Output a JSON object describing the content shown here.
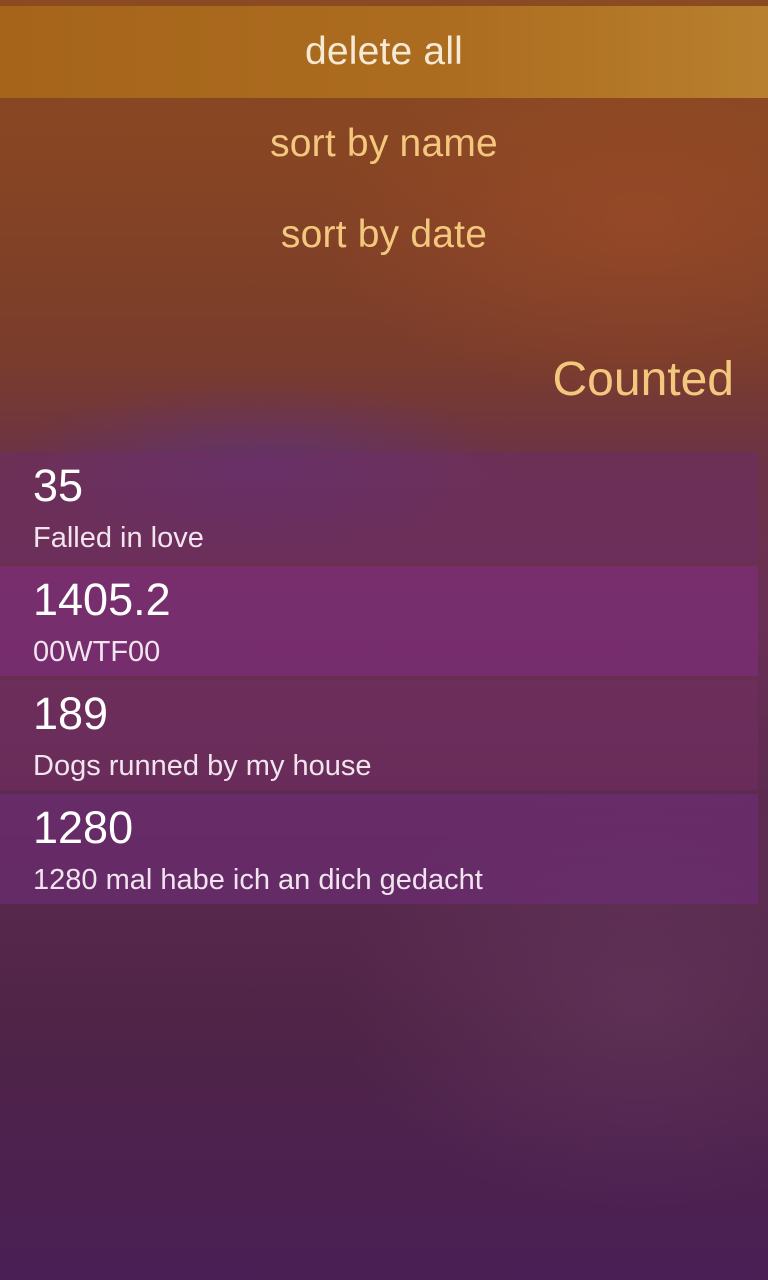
{
  "menu": {
    "items": [
      {
        "label": "delete all",
        "highlighted": true
      },
      {
        "label": "sort by name",
        "highlighted": false
      },
      {
        "label": "sort by date",
        "highlighted": false
      }
    ]
  },
  "header": {
    "title": "Counted"
  },
  "counters": [
    {
      "count": "35",
      "name": "Falled in love"
    },
    {
      "count": "1405.2",
      "name": "00WTF00"
    },
    {
      "count": "189",
      "name": "Dogs runned by my house"
    },
    {
      "count": "1280",
      "name": "1280 mal habe ich an dich gedacht"
    }
  ],
  "colors": {
    "highlight": "#ad6d20",
    "accent": "#f3c87e",
    "primary_text": "#ffffff"
  }
}
